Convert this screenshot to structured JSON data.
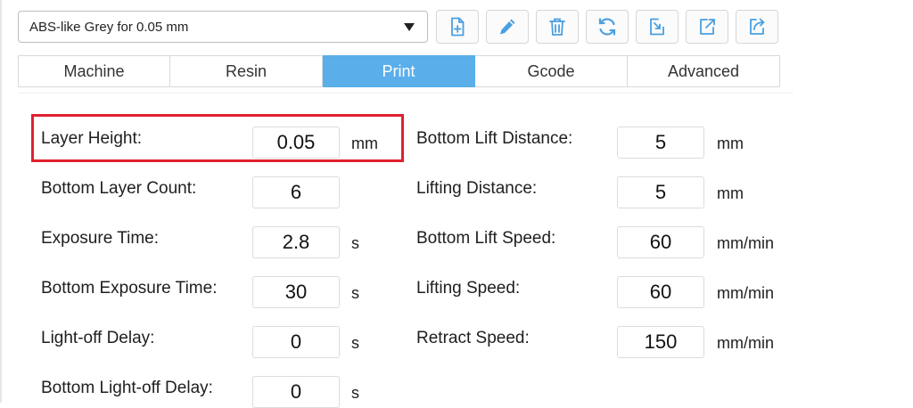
{
  "profile": {
    "selected": "ABS-like Grey for 0.05 mm"
  },
  "toolbar": {
    "buttons": [
      {
        "name": "new-profile",
        "icon": "file-plus-icon"
      },
      {
        "name": "edit-profile",
        "icon": "pencil-icon"
      },
      {
        "name": "delete-profile",
        "icon": "trash-icon"
      },
      {
        "name": "refresh-profile",
        "icon": "refresh-icon"
      },
      {
        "name": "import-profile",
        "icon": "import-icon"
      },
      {
        "name": "export-profile",
        "icon": "export-icon"
      },
      {
        "name": "share-profile",
        "icon": "share-icon"
      }
    ],
    "icon_color": "#4a9fe0"
  },
  "tabs": [
    {
      "label": "Machine",
      "active": false
    },
    {
      "label": "Resin",
      "active": false
    },
    {
      "label": "Print",
      "active": true
    },
    {
      "label": "Gcode",
      "active": false
    },
    {
      "label": "Advanced",
      "active": false
    }
  ],
  "left_fields": [
    {
      "label": "Layer Height:",
      "value": "0.05",
      "unit": "mm"
    },
    {
      "label": "Bottom Layer Count:",
      "value": "6",
      "unit": ""
    },
    {
      "label": "Exposure Time:",
      "value": "2.8",
      "unit": "s"
    },
    {
      "label": "Bottom Exposure Time:",
      "value": "30",
      "unit": "s"
    },
    {
      "label": "Light-off Delay:",
      "value": "0",
      "unit": "s"
    },
    {
      "label": "Bottom Light-off Delay:",
      "value": "0",
      "unit": "s"
    }
  ],
  "right_fields": [
    {
      "label": "Bottom Lift Distance:",
      "value": "5",
      "unit": "mm"
    },
    {
      "label": "Lifting Distance:",
      "value": "5",
      "unit": "mm"
    },
    {
      "label": "Bottom Lift Speed:",
      "value": "60",
      "unit": "mm/min"
    },
    {
      "label": "Lifting Speed:",
      "value": "60",
      "unit": "mm/min"
    },
    {
      "label": "Retract Speed:",
      "value": "150",
      "unit": "mm/min"
    }
  ],
  "colors": {
    "active_tab": "#5aaeea",
    "highlight": "#e0212f"
  }
}
